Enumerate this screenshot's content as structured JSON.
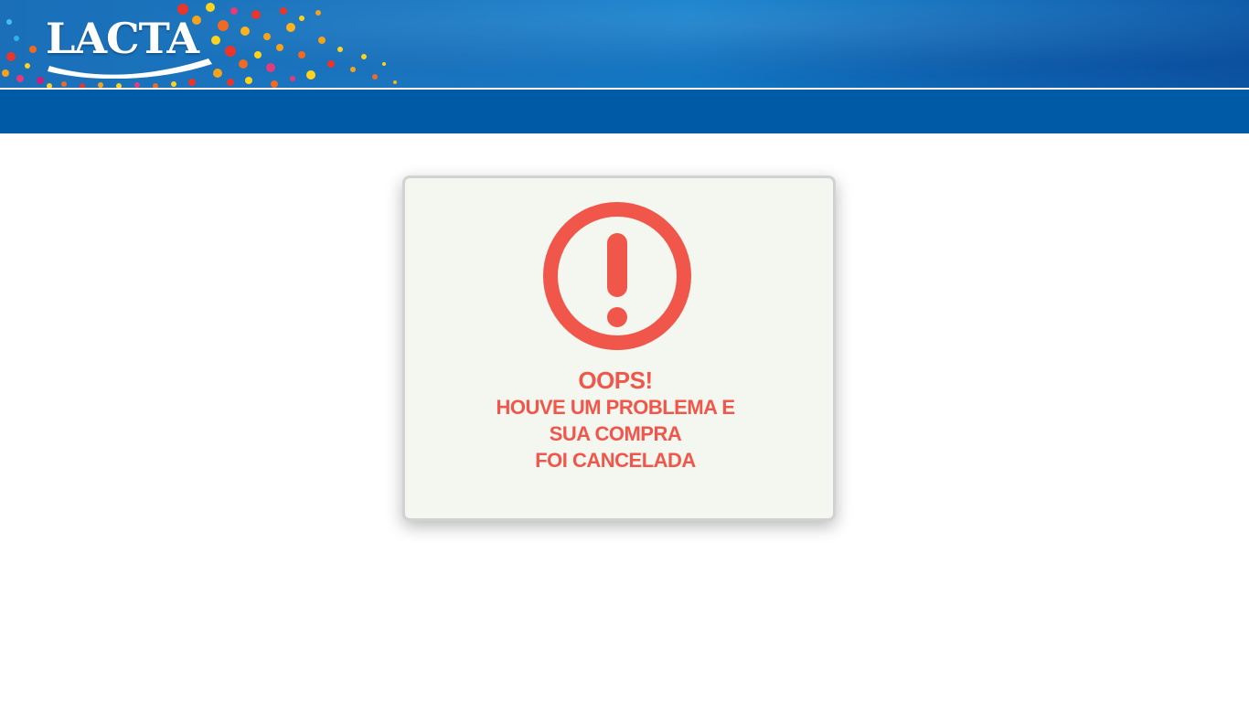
{
  "header": {
    "brand": "LACTA",
    "colors": {
      "header_blue": "#1a6fb8",
      "nav_blue": "#005aa6"
    }
  },
  "alert": {
    "icon": "exclamation-circle-icon",
    "color": "#f0574a",
    "title": "OOPS!",
    "message_lines": [
      "HOUVE UM PROBLEMA E",
      "SUA COMPRA",
      "FOI CANCELADA"
    ]
  }
}
